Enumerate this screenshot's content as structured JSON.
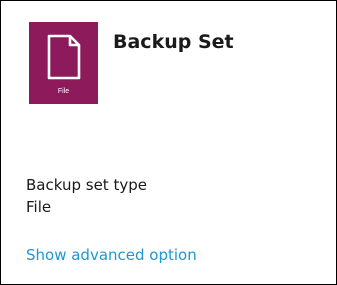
{
  "header": {
    "title": "Backup Set",
    "tile": {
      "icon": "file-icon",
      "label": "File",
      "color": "#8d1b5c"
    }
  },
  "backup_set_type": {
    "label": "Backup set type",
    "value": "File"
  },
  "advanced": {
    "link_label": "Show advanced option",
    "link_color": "#1d97d6"
  }
}
